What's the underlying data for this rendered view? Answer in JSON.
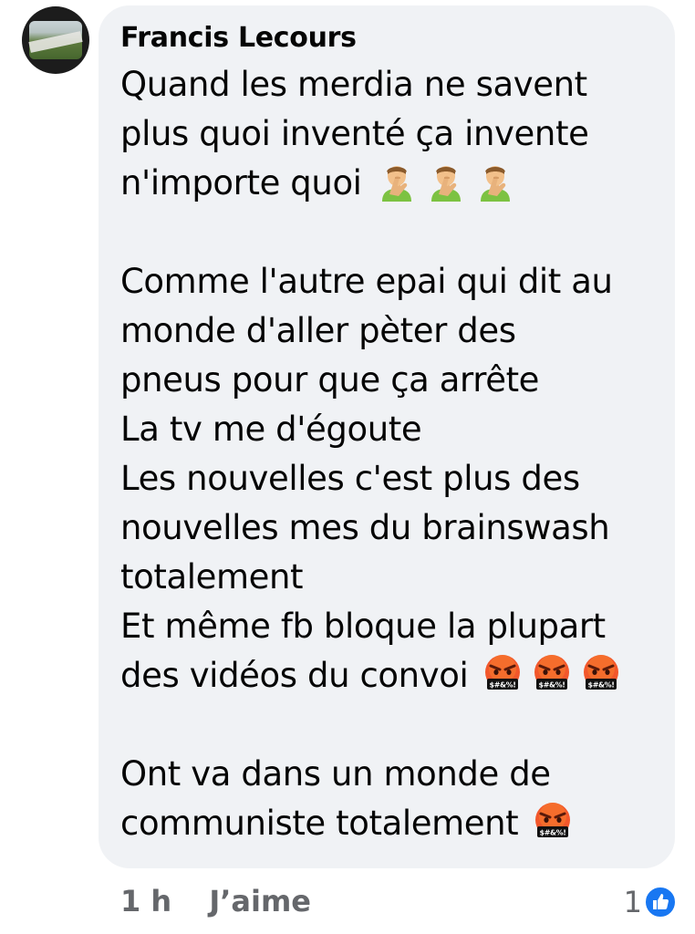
{
  "comment": {
    "author": "Francis Lecours",
    "lines": [
      {
        "text": "Quand les merdia ne savent"
      },
      {
        "text": "plus quoi inventé ça invente"
      },
      {
        "text": "n'importe quoi",
        "emojis": [
          "person-facepalming",
          "person-facepalming",
          "person-facepalming"
        ]
      },
      {
        "text": ""
      },
      {
        "text": "Comme l'autre epai qui dit au"
      },
      {
        "text": "monde d'aller pèter des"
      },
      {
        "text": "pneus pour que ça arrête"
      },
      {
        "text": "La tv me d'égoute"
      },
      {
        "text": "Les nouvelles c'est plus des"
      },
      {
        "text": "nouvelles mes du brainswash"
      },
      {
        "text": "totalement"
      },
      {
        "text": "Et même fb bloque la plupart"
      },
      {
        "text": "des vidéos du convoi",
        "emojis": [
          "face-with-symbols-on-mouth",
          "face-with-symbols-on-mouth",
          "face-with-symbols-on-mouth"
        ]
      },
      {
        "text": ""
      },
      {
        "text": "Ont va dans un monde de"
      },
      {
        "text": "communiste totalement",
        "emojis": [
          "face-with-symbols-on-mouth"
        ]
      }
    ]
  },
  "footer": {
    "time": "1 h",
    "like_label": "J’aime",
    "reaction_count": "1",
    "reaction_icon": "like-icon",
    "reaction_color": "#1877f2"
  }
}
